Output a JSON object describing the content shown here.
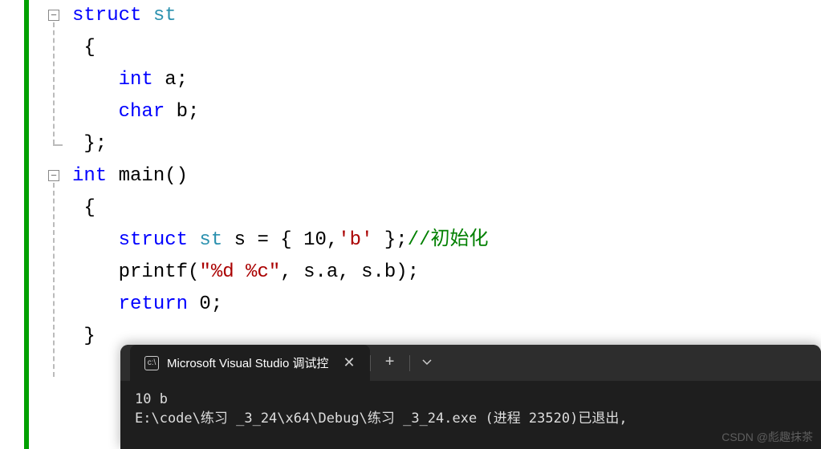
{
  "code": {
    "line1_kw": "struct",
    "line1_type": " st",
    "line2": "{",
    "line3_kw": "int",
    "line3_rest": " a;",
    "line4_kw": "char",
    "line4_rest": " b;",
    "line5": "};",
    "line6_kw": "int",
    "line6_rest": " main()",
    "line7": "{",
    "line8_kw": "struct",
    "line8_type": " st",
    "line8_mid": " s = { 10,",
    "line8_str": "'b'",
    "line8_end": " };",
    "line8_comment": "//初始化",
    "line9_fn": "printf",
    "line9_open": "(",
    "line9_str": "\"%d %c\"",
    "line9_rest": ", s.a, s.b);",
    "line10_kw": "return",
    "line10_rest": " 0;",
    "line11": "}"
  },
  "fold": {
    "minus": "−"
  },
  "terminal": {
    "tab_title": "Microsoft Visual Studio 调试控",
    "icon_text": "c:\\",
    "output_line1": "10 b",
    "output_line2": "E:\\code\\练习 _3_24\\x64\\Debug\\练习 _3_24.exe (进程 23520)已退出,"
  },
  "watermark": "CSDN @彪趣抹茶"
}
